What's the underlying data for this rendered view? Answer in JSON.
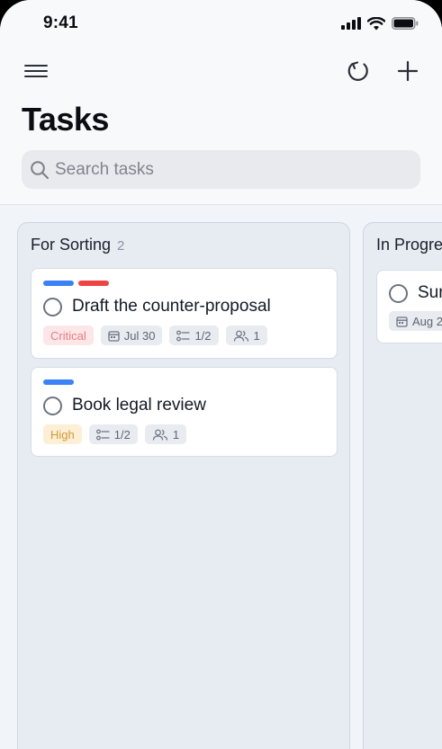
{
  "status_bar": {
    "time": "9:41"
  },
  "header": {
    "title": "Tasks"
  },
  "search": {
    "placeholder": "Search tasks"
  },
  "colors": {
    "label_blue": "#3b82f6",
    "label_red": "#ef4444"
  },
  "columns": [
    {
      "title": "For Sorting",
      "count": "2",
      "cards": [
        {
          "labels": [
            "blue",
            "red"
          ],
          "title": "Draft the counter-proposal",
          "priority": "Critical",
          "due": "Jul 30",
          "checklist": "1/2",
          "assignees": "1"
        },
        {
          "labels": [
            "blue"
          ],
          "title": "Book legal review",
          "priority": "High",
          "checklist": "1/2",
          "assignees": "1"
        }
      ]
    },
    {
      "title": "In Progre",
      "cards": [
        {
          "title": "Sur",
          "due": "Aug 2"
        }
      ]
    }
  ]
}
